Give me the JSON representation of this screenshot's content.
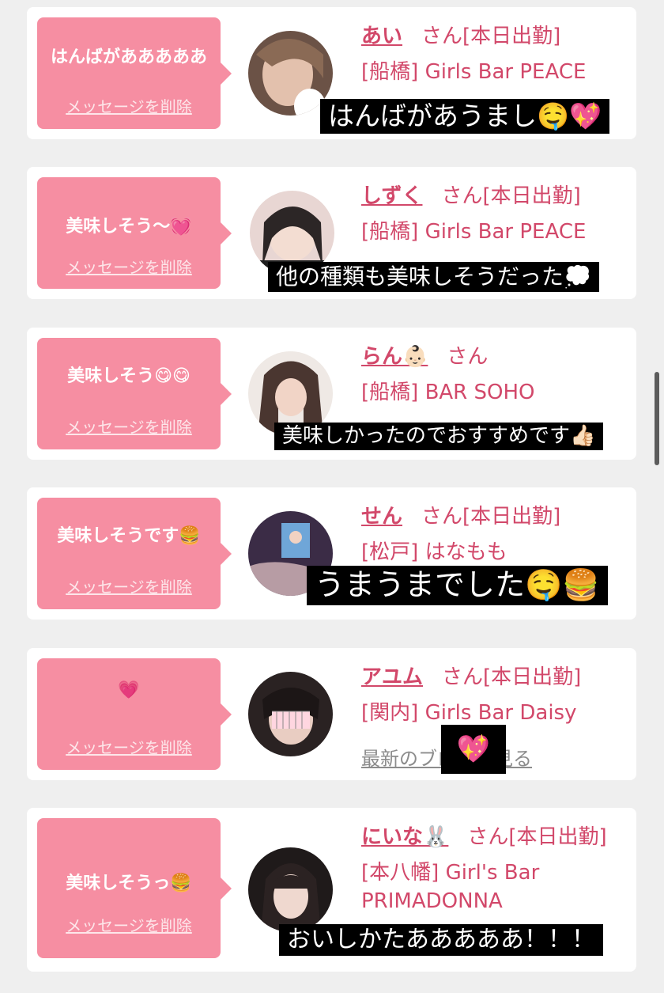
{
  "delete_label": "メッセージを削除",
  "san": "さん",
  "entries": [
    {
      "message": "はんばがあああああ",
      "name": "あい",
      "suffix": "さん[本日出勤]",
      "area": "[船橋]",
      "shop": "Girls Bar PEACE",
      "caption": "はんばがあうまし🤤💖"
    },
    {
      "message": "美味しそう〜💓",
      "name": "しずく",
      "suffix": "さん[本日出勤]",
      "area": "[船橋]",
      "shop": "Girls Bar PEACE",
      "caption": "他の種類も美味しそうだった💭"
    },
    {
      "message": "美味しそう😋😋",
      "name": "らん👶🏻",
      "suffix": "さん",
      "area": "[船橋]",
      "shop": "BAR SOHO",
      "caption": "美味しかったのでおすすめです👍🏻"
    },
    {
      "message": "美味しそうです🍔",
      "name": "せん",
      "suffix": "さん[本日出勤]",
      "area": "[松戸]",
      "shop": "はなもも",
      "caption": "うまうまでした🤤🍔"
    },
    {
      "message": "💗",
      "name": "アユム",
      "suffix": "さん[本日出勤]",
      "area": "[関内]",
      "shop": "Girls Bar Daisy",
      "blog_link": "最新のブログを見る",
      "overlay_emoji": "💖"
    },
    {
      "message": "美味しそうっ🍔",
      "name": "にいな🐰",
      "suffix": "さん[本日出勤]",
      "area": "[本八幡]",
      "shop_line1": "Girl's Bar",
      "shop_line2": "PRIMADONNA",
      "caption": "おいしかたあああああ！！！"
    }
  ],
  "colors": {
    "bubble": "#f68ea2",
    "accent": "#d2486a",
    "background": "#efefef"
  }
}
